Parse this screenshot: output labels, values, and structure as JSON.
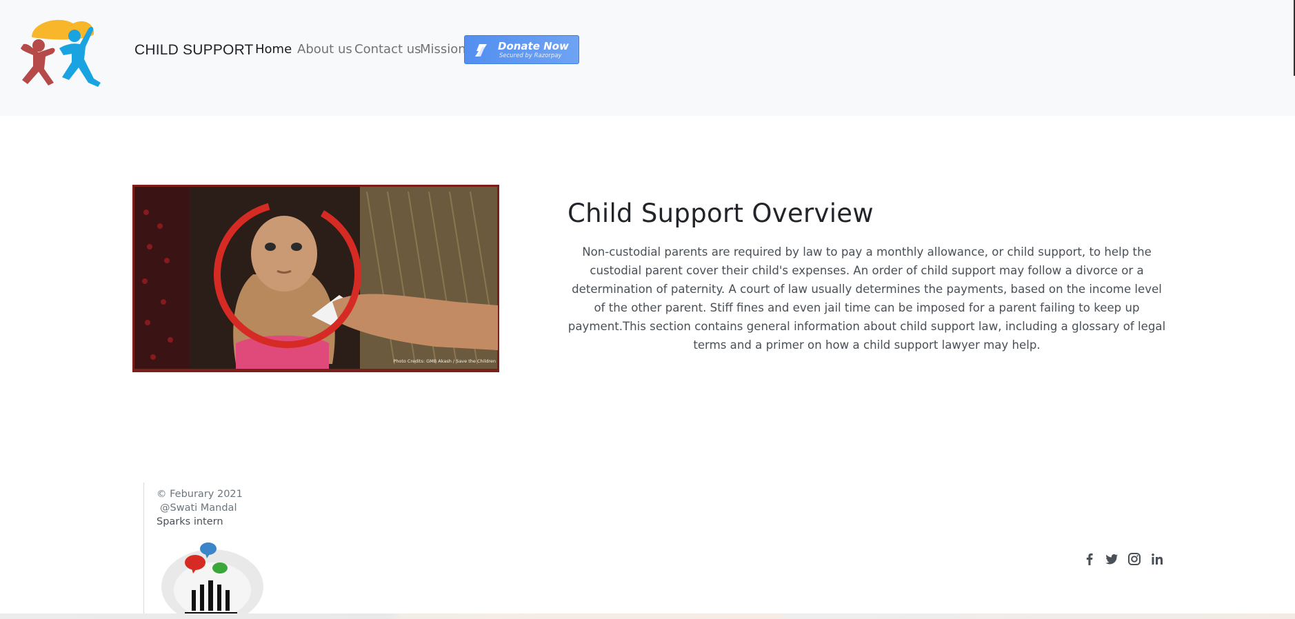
{
  "navbar": {
    "brand": "CHILD SUPPORT",
    "links": [
      {
        "label": "Home",
        "active": true
      },
      {
        "label": "About us",
        "active": false
      },
      {
        "label": "Contact us",
        "active": false
      },
      {
        "label": "Mission",
        "active": false
      }
    ],
    "donate": {
      "label": "Donate Now",
      "sublabel": "Secured by Razorpay",
      "icon": "razorpay-icon",
      "color": "#528ff0"
    }
  },
  "hero": {
    "image_caption": "Photo Credits: GMB Akash / Save the Children",
    "title": "Child Support Overview",
    "description": "Non-custodial parents are required by law to pay a monthly allowance, or child support, to help the custodial parent cover their child's expenses. An order of child support may follow a divorce or a determination of paternity. A court of law usually determines the payments, based on the income level of the other parent. Stiff fines and even jail time can be imposed for a parent failing to keep up payment.This section contains general information about child support law, including a glossary of legal terms and a primer on how a child support lawyer may help."
  },
  "footer": {
    "copyright": "© Feburary 2021",
    "author": "@Swati Mandal",
    "role": "Sparks intern",
    "social": [
      "facebook-icon",
      "twitter-icon",
      "instagram-icon",
      "linkedin-icon"
    ]
  },
  "colors": {
    "navbar_bg": "#f8f9fa",
    "accent_red": "#d62b24",
    "text_muted": "#6c757d"
  }
}
